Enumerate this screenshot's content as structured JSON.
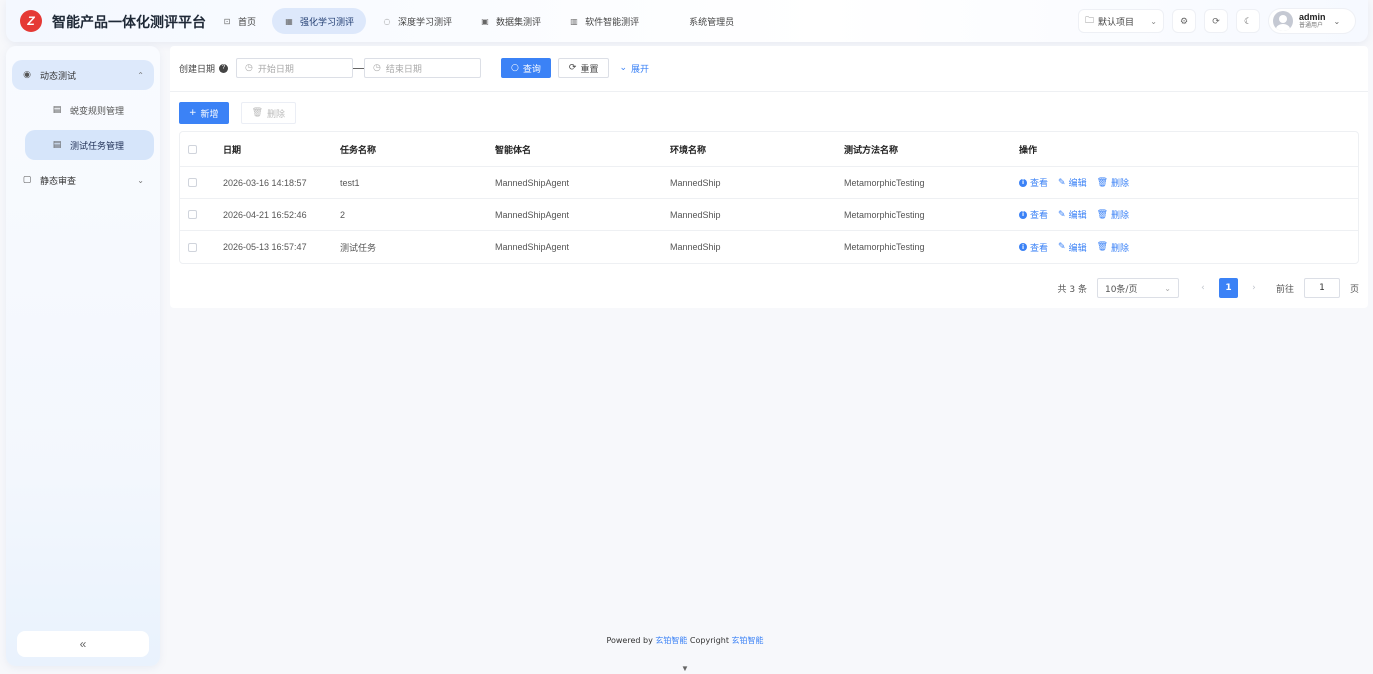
{
  "app": {
    "logo_text": "Z",
    "title": "智能产品一体化测评平台"
  },
  "nav": [
    {
      "label": "首页",
      "icon": "home-icon",
      "glyph": "⊡",
      "active": false
    },
    {
      "label": "强化学习测评",
      "icon": "grid-icon",
      "glyph": "▦",
      "active": true
    },
    {
      "label": "深度学习测评",
      "icon": "target-icon",
      "glyph": "◌",
      "active": false
    },
    {
      "label": "数据集测评",
      "icon": "box-icon",
      "glyph": "▣",
      "active": false
    },
    {
      "label": "软件智能测评",
      "icon": "table-icon",
      "glyph": "▥",
      "active": false
    },
    {
      "label": "系统管理员",
      "icon": "",
      "glyph": "",
      "active": false
    }
  ],
  "header": {
    "project_select": "默认项目",
    "user_name": "admin",
    "user_role": "普通用户"
  },
  "sidebar": {
    "groups": [
      {
        "label": "动态测试",
        "icon": "play-circle-icon",
        "open": true
      },
      {
        "label": "静态审查",
        "icon": "document-icon",
        "open": false
      }
    ],
    "items": [
      {
        "label": "蜕变规则管理",
        "icon": "rule-icon",
        "active": false
      },
      {
        "label": "测试任务管理",
        "icon": "task-icon",
        "active": true
      }
    ],
    "collapse_label": "«"
  },
  "filters": {
    "date_label": "创建日期",
    "start_placeholder": "开始日期",
    "end_placeholder": "结束日期",
    "search_label": "查询",
    "reset_label": "重置",
    "expand_label": "展开"
  },
  "actions": {
    "add_label": "新增",
    "delete_label": "删除"
  },
  "table": {
    "headers": [
      "日期",
      "任务名称",
      "智能体名",
      "环境名称",
      "测试方法名称",
      "操作"
    ],
    "rows": [
      {
        "date": "2026-03-16 14:18:57",
        "name": "test1",
        "agent": "MannedShipAgent",
        "env": "MannedShip",
        "method": "MetamorphicTesting"
      },
      {
        "date": "2026-04-21 16:52:46",
        "name": "2",
        "agent": "MannedShipAgent",
        "env": "MannedShip",
        "method": "MetamorphicTesting"
      },
      {
        "date": "2026-05-13 16:57:47",
        "name": "测试任务",
        "agent": "MannedShipAgent",
        "env": "MannedShip",
        "method": "MetamorphicTesting"
      }
    ],
    "ops": {
      "view": "查看",
      "edit": "编辑",
      "delete": "删除"
    }
  },
  "pagination": {
    "total": "共 3 条",
    "page_size": "10条/页",
    "current_page": "1",
    "goto_label": "前往",
    "goto_value": "1",
    "page_suffix": "页"
  },
  "footer": {
    "powered_by": "Powered by",
    "brand1": "玄铂智能",
    "copyright": "Copyright",
    "brand2": "玄铂智能"
  },
  "colors": {
    "primary": "#3b82f6",
    "logo": "#e53935"
  }
}
